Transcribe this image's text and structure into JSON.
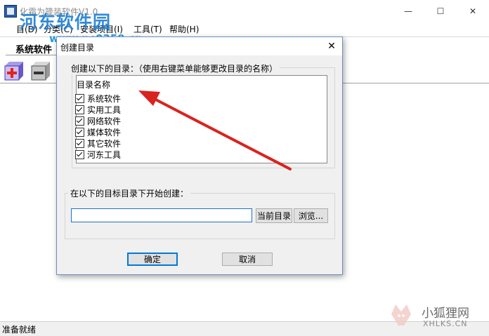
{
  "window": {
    "title": "化霜为箴装软件V1.0",
    "minimize_glyph": "—",
    "maximize_glyph": "☐",
    "close_glyph": "✕"
  },
  "menu": [
    "目(D)",
    "分类(C)",
    "安装项目(I)",
    "工具(T)",
    "帮助(H)"
  ],
  "tab": {
    "label": "系统软件"
  },
  "toolbar": {
    "add_icon": "add-icon",
    "remove_icon": "remove-icon"
  },
  "status": {
    "text": "准备就绪"
  },
  "watermarks": {
    "site_name": "河东软件园",
    "site_url": "www.pc0359.cn",
    "logo_text": "小狐狸网",
    "logo_sub": "XHLKS.CN"
  },
  "dialog": {
    "title": "创建目录",
    "close_glyph": "✕",
    "group1_label": "创建以下的目录：（使用右键菜单能够更改目录的名称）",
    "list_header": "目录名称",
    "items": [
      {
        "label": "系统软件",
        "checked": true
      },
      {
        "label": "实用工具",
        "checked": true
      },
      {
        "label": "网络软件",
        "checked": true
      },
      {
        "label": "媒体软件",
        "checked": true
      },
      {
        "label": "其它软件",
        "checked": true
      },
      {
        "label": "河东工具",
        "checked": true
      }
    ],
    "group2_label": "在以下的目标目录下开始创建：",
    "path_value": "",
    "current_dir_button": "当前目录",
    "browse_button": "浏览...",
    "ok_button": "确定",
    "cancel_button": "取消"
  },
  "colors": {
    "accent": "#0078d7",
    "annotation_arrow": "#d9231f",
    "watermark_blue": "#1f7fd1"
  }
}
